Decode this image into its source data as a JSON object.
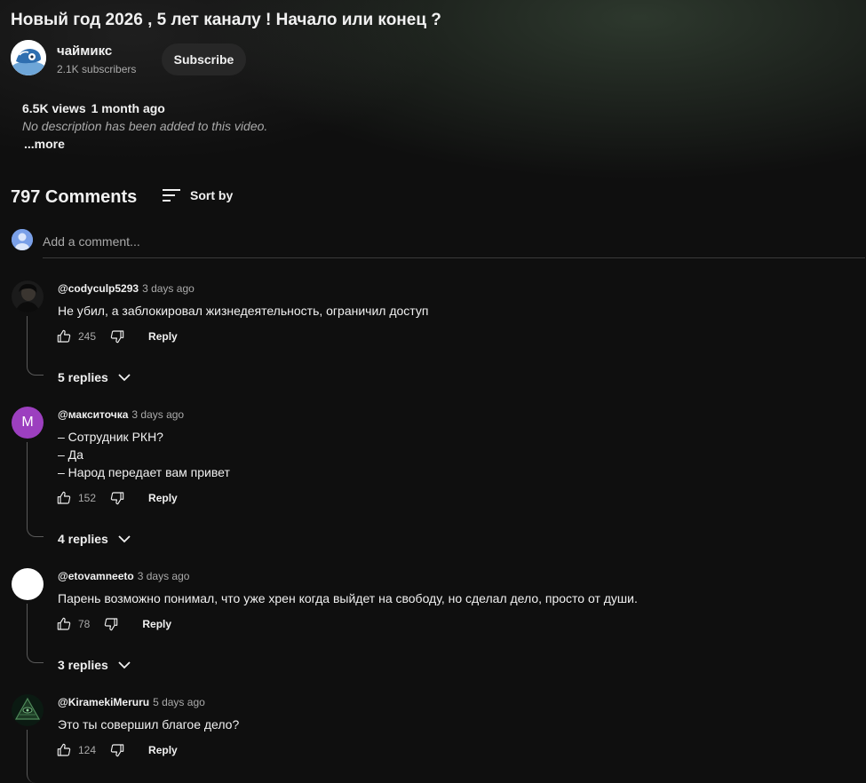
{
  "video": {
    "title": "Новый год 2026 , 5 лет каналу ! Начало или конец ?",
    "views": "6.5K views",
    "age": "1 month ago",
    "description": "No description has been added to this video.",
    "more_label": "...more"
  },
  "channel": {
    "name": "чаймикс",
    "subscribers": "2.1K subscribers",
    "subscribe_label": "Subscribe"
  },
  "comments_section": {
    "count_label": "797 Comments",
    "sort_label": "Sort by",
    "add_placeholder": "Add a comment..."
  },
  "comments": [
    {
      "author": "@codyculp5293",
      "time": "3 days ago",
      "lines": [
        "Не убил, а заблокировал жизнедеятельность, ограничил доступ"
      ],
      "likes": "245",
      "reply_label": "Reply",
      "replies_label": "5 replies"
    },
    {
      "author": "@макситочка",
      "time": "3 days ago",
      "avatar_letter": "M",
      "lines": [
        "– Сотрудник РКН?",
        "– Да",
        "– Народ передает вам привет"
      ],
      "likes": "152",
      "reply_label": "Reply",
      "replies_label": "4 replies"
    },
    {
      "author": "@etovamneeto",
      "time": "3 days ago",
      "lines": [
        "Парень возможно понимал, что уже хрен когда выйдет на свободу, но сделал дело, просто от души."
      ],
      "likes": "78",
      "reply_label": "Reply",
      "replies_label": "3 replies"
    },
    {
      "author": "@KiramekiMeruru",
      "time": "5 days ago",
      "lines": [
        "Это ты совершил благое дело?"
      ],
      "likes": "124",
      "reply_label": "Reply"
    }
  ],
  "colors": {
    "background": "#0f0f0f",
    "secondary_text": "#aaaaaa",
    "button_bg": "#272727",
    "avatar_purple": "#9c3fbf"
  }
}
